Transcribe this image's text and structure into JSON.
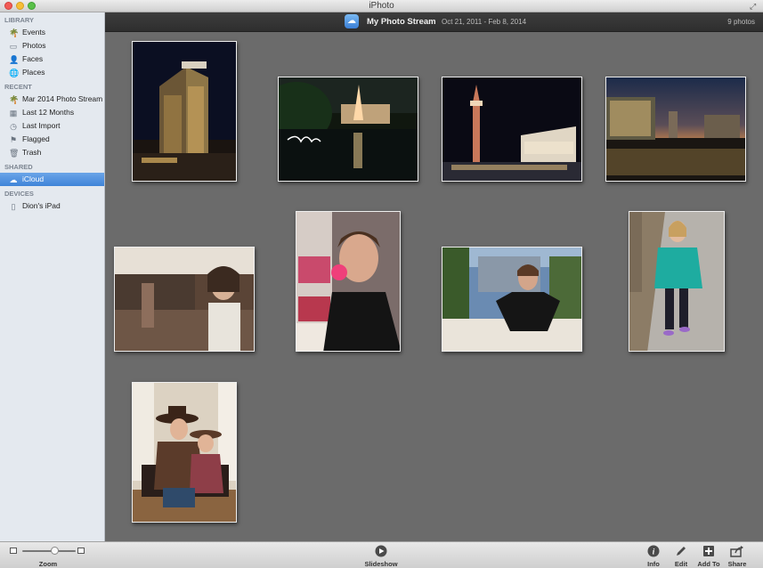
{
  "window": {
    "title": "iPhoto"
  },
  "sidebar": {
    "library_heading": "LIBRARY",
    "library": [
      {
        "label": "Events",
        "icon": "palm-tree-icon"
      },
      {
        "label": "Photos",
        "icon": "photo-stack-icon"
      },
      {
        "label": "Faces",
        "icon": "person-icon"
      },
      {
        "label": "Places",
        "icon": "globe-icon"
      }
    ],
    "recent_heading": "RECENT",
    "recent": [
      {
        "label": "Mar 2014 Photo Stream",
        "icon": "palm-tree-icon"
      },
      {
        "label": "Last 12 Months",
        "icon": "calendar-icon"
      },
      {
        "label": "Last Import",
        "icon": "clock-icon"
      },
      {
        "label": "Flagged",
        "icon": "flag-icon"
      },
      {
        "label": "Trash",
        "icon": "trash-icon"
      }
    ],
    "shared_heading": "SHARED",
    "shared": [
      {
        "label": "iCloud",
        "icon": "cloud-icon",
        "selected": true
      }
    ],
    "devices_heading": "DEVICES",
    "devices": [
      {
        "label": "Dion's iPad",
        "icon": "ipad-icon"
      }
    ]
  },
  "header": {
    "title": "My Photo Stream",
    "date_range": "Oct 21, 2011 - Feb 8, 2014",
    "count": "9 photos"
  },
  "photos": [
    {
      "name": "photo-caesars-tower-night"
    },
    {
      "name": "photo-bellagio-fountain"
    },
    {
      "name": "photo-venetian-campanile"
    },
    {
      "name": "photo-strip-skyline-dusk"
    },
    {
      "name": "photo-casino-woman"
    },
    {
      "name": "photo-woman-clown-nose"
    },
    {
      "name": "photo-woman-balcony"
    },
    {
      "name": "photo-girl-sidewalk"
    },
    {
      "name": "photo-couple-cowboy-hats"
    }
  ],
  "toolbar": {
    "zoom_label": "Zoom",
    "zoom_level": 0.6,
    "slideshow_label": "Slideshow",
    "info_label": "Info",
    "edit_label": "Edit",
    "addto_label": "Add To",
    "share_label": "Share"
  }
}
